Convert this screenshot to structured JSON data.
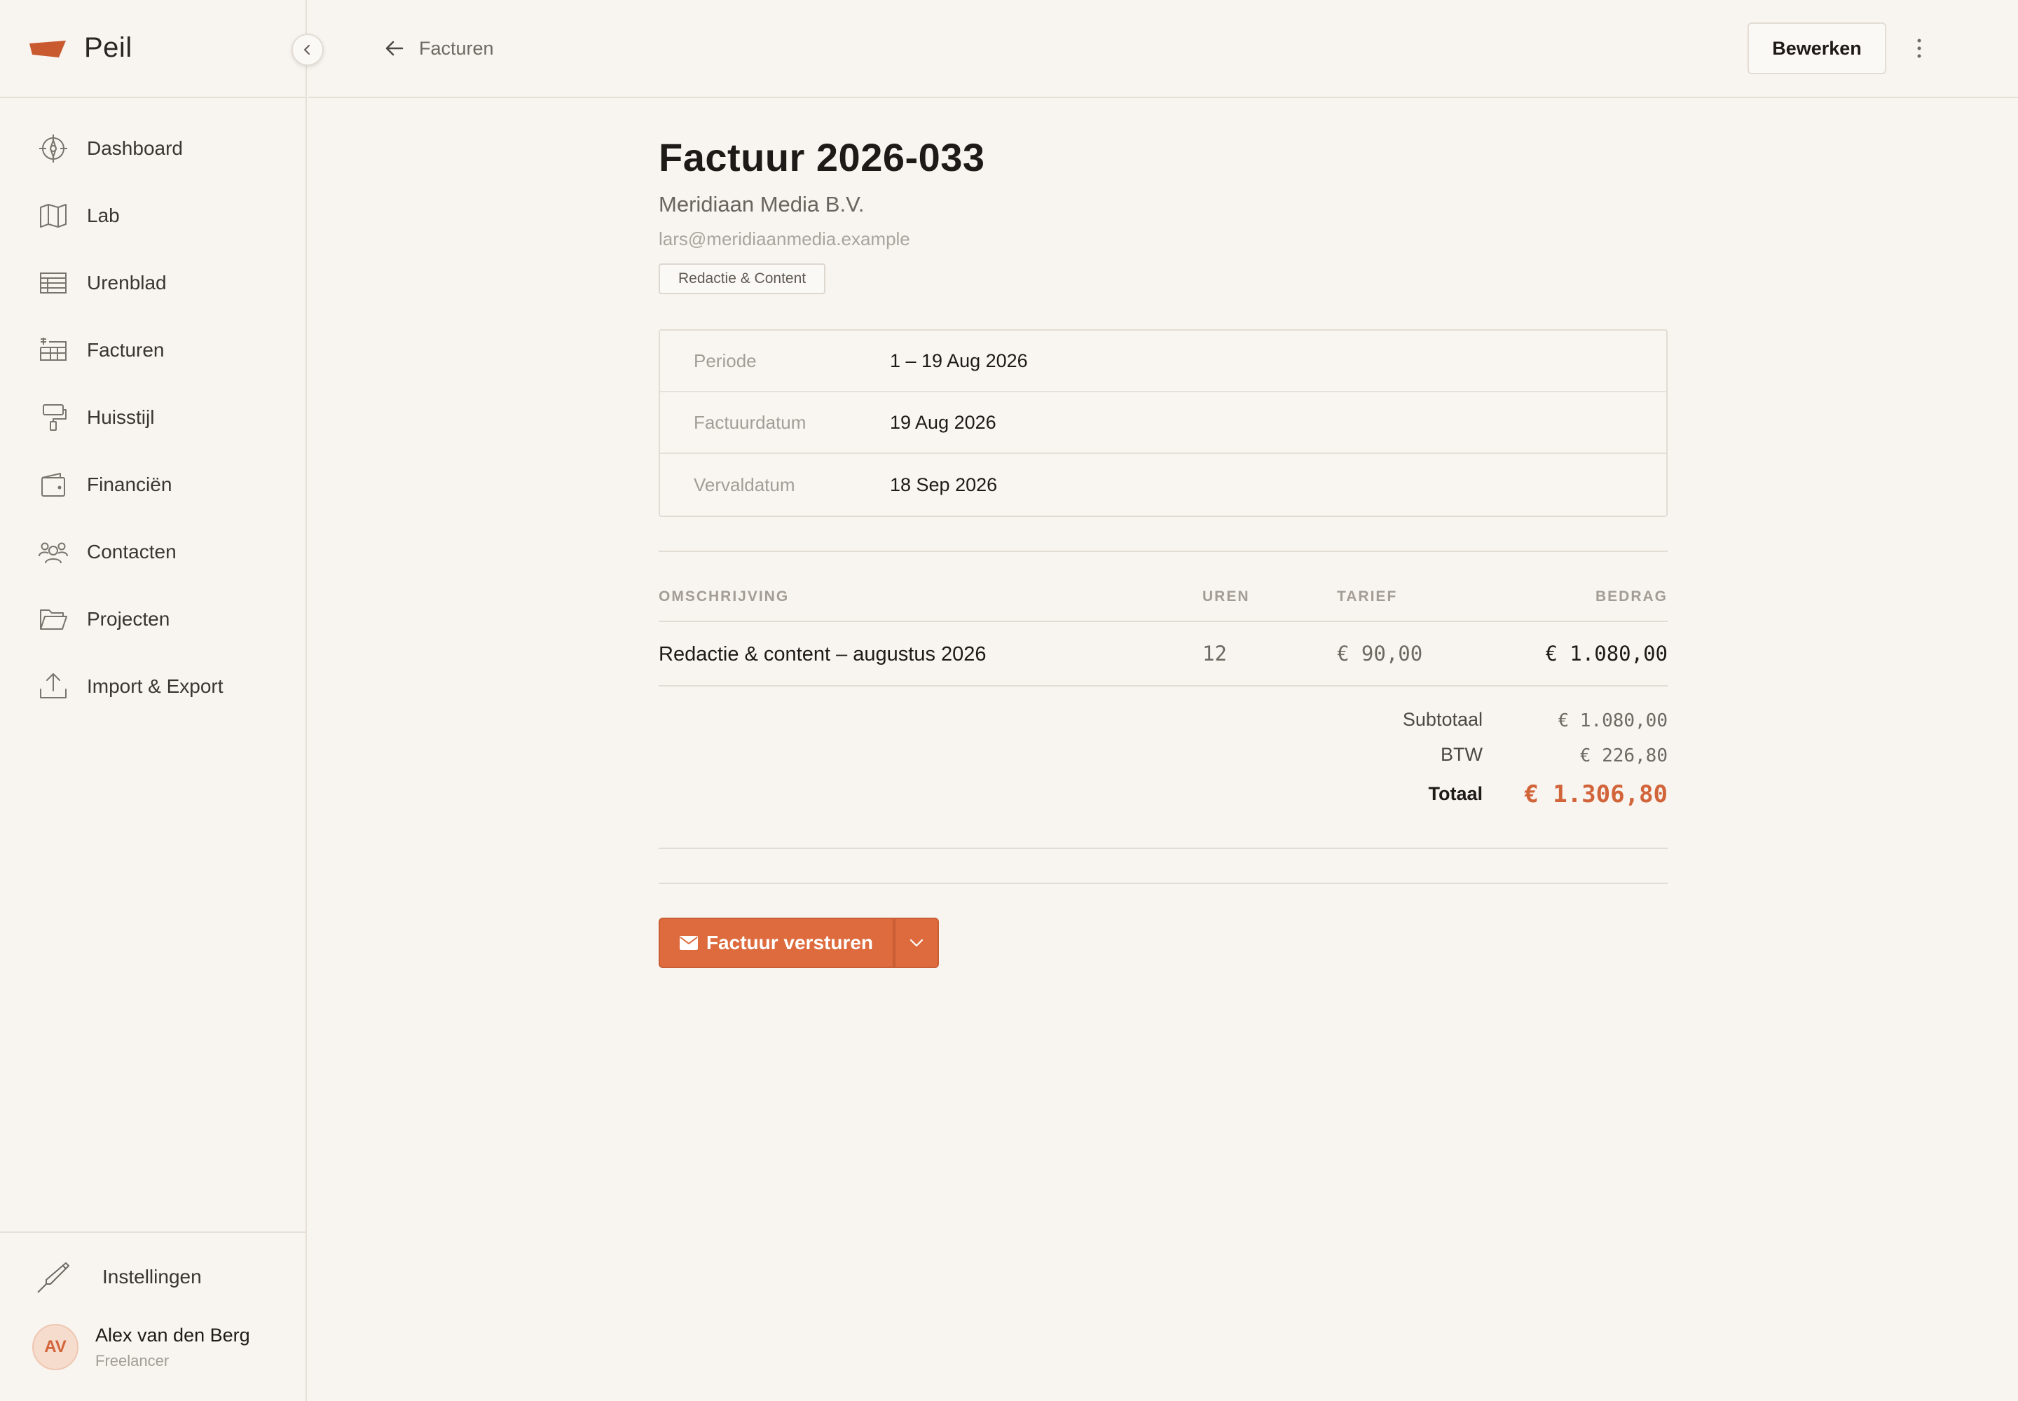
{
  "app": {
    "name": "Peil",
    "accent": "#dd6b3e"
  },
  "sidebar": {
    "items": [
      {
        "label": "Dashboard",
        "icon": "compass-icon"
      },
      {
        "label": "Lab",
        "icon": "map-icon"
      },
      {
        "label": "Urenblad",
        "icon": "timesheet-icon"
      },
      {
        "label": "Facturen",
        "icon": "invoice-icon"
      },
      {
        "label": "Huisstijl",
        "icon": "paint-roller-icon"
      },
      {
        "label": "Financiën",
        "icon": "wallet-icon"
      },
      {
        "label": "Contacten",
        "icon": "users-icon"
      },
      {
        "label": "Projecten",
        "icon": "folder-icon"
      },
      {
        "label": "Import & Export",
        "icon": "upload-icon"
      }
    ],
    "settings_label": "Instellingen",
    "user": {
      "initials": "AV",
      "name": "Alex van den Berg",
      "role": "Freelancer"
    }
  },
  "header": {
    "back_label": "Facturen",
    "edit_label": "Bewerken"
  },
  "invoice": {
    "title": "Factuur 2026-033",
    "client": "Meridiaan Media B.V.",
    "email": "lars@meridiaanmedia.example",
    "tag": "Redactie & Content",
    "meta": [
      {
        "key": "Periode",
        "value": "1 – 19 Aug 2026"
      },
      {
        "key": "Factuurdatum",
        "value": "19 Aug 2026"
      },
      {
        "key": "Vervaldatum",
        "value": "18 Sep 2026"
      }
    ],
    "columns": {
      "description": "OMSCHRIJVING",
      "hours": "UREN",
      "rate": "TARIEF",
      "amount": "BEDRAG"
    },
    "lines": [
      {
        "description": "Redactie & content – augustus 2026",
        "hours": "12",
        "rate": "€ 90,00",
        "amount": "€ 1.080,00"
      }
    ],
    "totals": {
      "subtotal_label": "Subtotaal",
      "subtotal": "€ 1.080,00",
      "vat_label": "BTW",
      "vat": "€ 226,80",
      "total_label": "Totaal",
      "total": "€ 1.306,80"
    },
    "send_label": "Factuur versturen"
  }
}
